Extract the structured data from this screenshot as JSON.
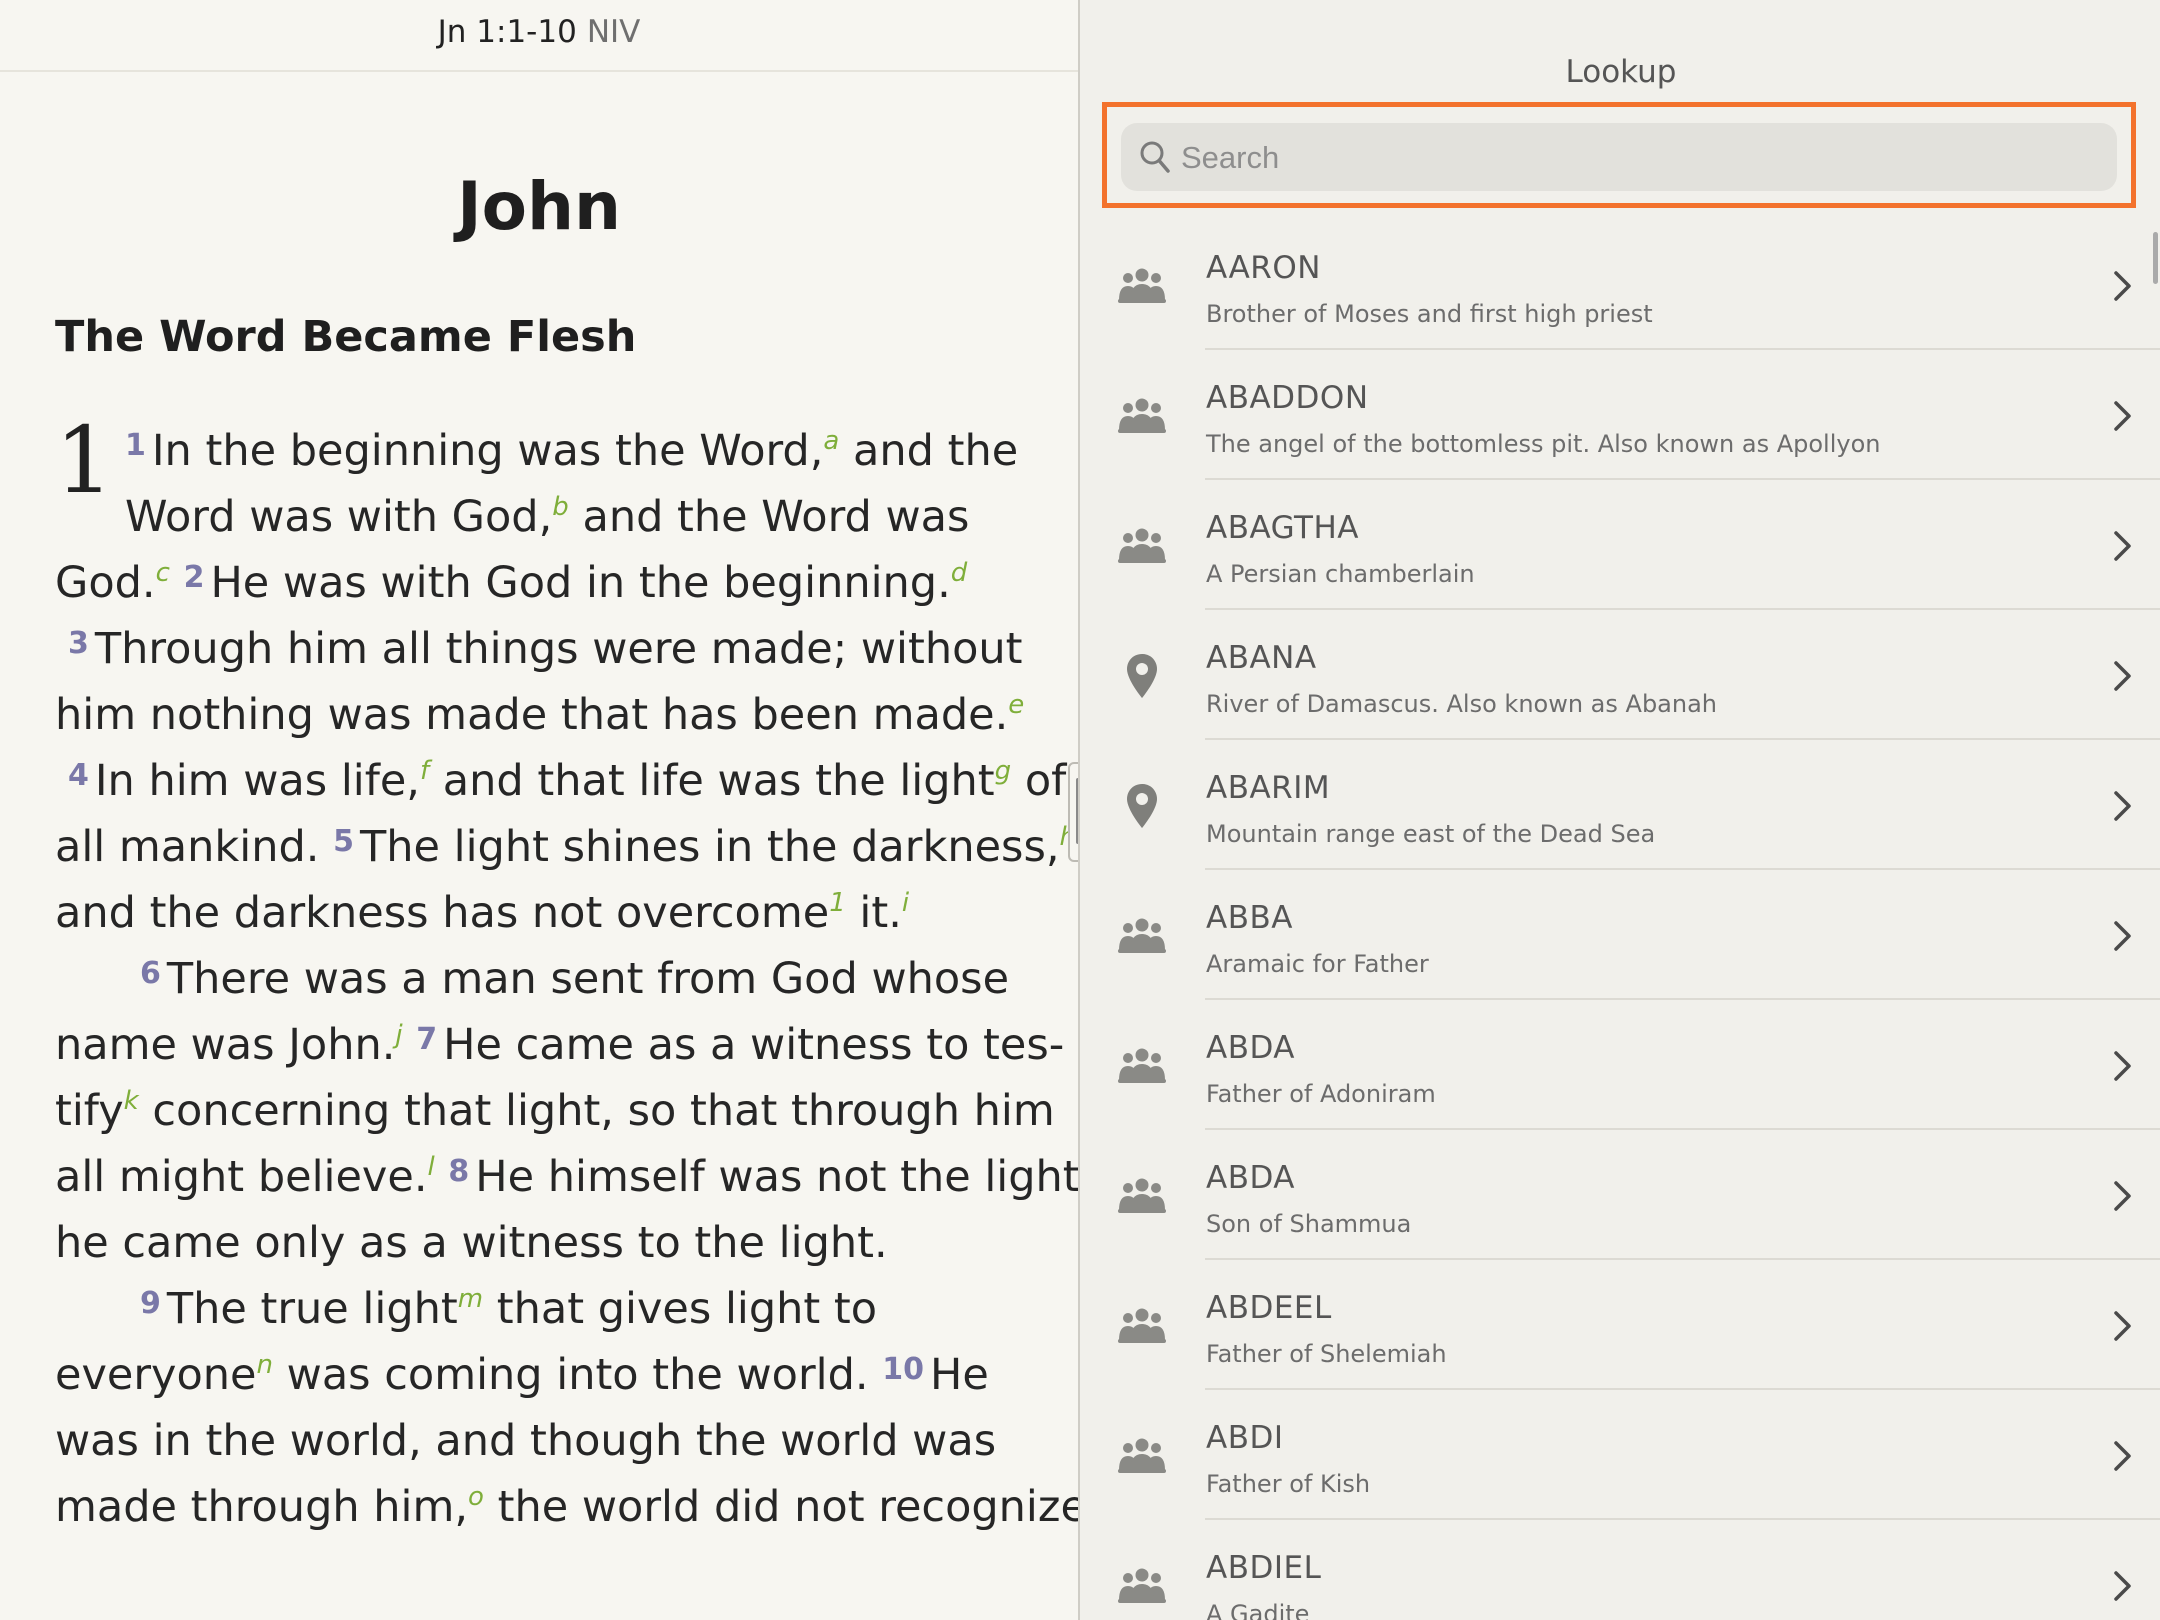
{
  "reader": {
    "reference": "Jn 1:1-10",
    "version": "NIV",
    "book_title": "John",
    "section_heading": "The Word Became Flesh",
    "chapter_number": "1",
    "lines": [
      [
        {
          "t": "n",
          "v": "1"
        },
        {
          "t": "x",
          "v": "In the beginning was the Word,"
        },
        {
          "t": "f",
          "v": "a"
        },
        {
          "t": "x",
          "v": " and the"
        }
      ],
      [
        {
          "t": "x",
          "v": "Word was with God,"
        },
        {
          "t": "f",
          "v": "b"
        },
        {
          "t": "x",
          "v": " and the Word was"
        }
      ],
      [
        {
          "t": "x",
          "v": "God."
        },
        {
          "t": "f",
          "v": "c"
        },
        {
          "t": "x",
          "v": "  "
        },
        {
          "t": "n",
          "v": "2"
        },
        {
          "t": "x",
          "v": "He was with God in the beginning."
        },
        {
          "t": "f",
          "v": "d"
        }
      ],
      [
        {
          "t": "n",
          "v": "3"
        },
        {
          "t": "x",
          "v": "Through him all things were made; without"
        }
      ],
      [
        {
          "t": "x",
          "v": "him nothing was made that has been made."
        },
        {
          "t": "f",
          "v": "e"
        }
      ],
      [
        {
          "t": "n",
          "v": "4"
        },
        {
          "t": "x",
          "v": "In him was life,"
        },
        {
          "t": "f",
          "v": "f"
        },
        {
          "t": "x",
          "v": " and that life was the light"
        },
        {
          "t": "f",
          "v": "g"
        },
        {
          "t": "x",
          "v": " of"
        }
      ],
      [
        {
          "t": "x",
          "v": "all mankind.  "
        },
        {
          "t": "n",
          "v": "5"
        },
        {
          "t": "x",
          "v": "The light shines in the darkness,"
        },
        {
          "t": "f",
          "v": "h"
        }
      ],
      [
        {
          "t": "x",
          "v": "and the darkness has not overcome"
        },
        {
          "t": "f",
          "v": "1"
        },
        {
          "t": "x",
          "v": " it."
        },
        {
          "t": "f",
          "v": "i"
        }
      ],
      [
        {
          "t": "n",
          "v": "6"
        },
        {
          "t": "x",
          "v": "There was a man sent from God whose"
        }
      ],
      [
        {
          "t": "x",
          "v": "name was John."
        },
        {
          "t": "f",
          "v": "j"
        },
        {
          "t": "x",
          "v": "  "
        },
        {
          "t": "n",
          "v": "7"
        },
        {
          "t": "x",
          "v": "He came as a witness to tes-"
        }
      ],
      [
        {
          "t": "x",
          "v": "tify"
        },
        {
          "t": "f",
          "v": "k"
        },
        {
          "t": "x",
          "v": " concerning that light, so that through him"
        }
      ],
      [
        {
          "t": "x",
          "v": "all might believe."
        },
        {
          "t": "f",
          "v": "l"
        },
        {
          "t": "x",
          "v": "  "
        },
        {
          "t": "n",
          "v": "8"
        },
        {
          "t": "x",
          "v": "He himself was not the light;"
        }
      ],
      [
        {
          "t": "x",
          "v": "he came only as a witness to the light."
        }
      ],
      [
        {
          "t": "n",
          "v": "9"
        },
        {
          "t": "x",
          "v": "The true light"
        },
        {
          "t": "f",
          "v": "m"
        },
        {
          "t": "x",
          "v": " that gives light to"
        }
      ],
      [
        {
          "t": "x",
          "v": "everyone"
        },
        {
          "t": "f",
          "v": "n"
        },
        {
          "t": "x",
          "v": " was coming into the world.  "
        },
        {
          "t": "n",
          "v": "10"
        },
        {
          "t": "x",
          "v": "He"
        }
      ],
      [
        {
          "t": "x",
          "v": "was in the world, and though the world was"
        }
      ],
      [
        {
          "t": "x",
          "v": "made through him,"
        },
        {
          "t": "f",
          "v": "o"
        },
        {
          "t": "x",
          "v": " the world did not recognize"
        }
      ]
    ]
  },
  "lookup": {
    "title": "Lookup",
    "search_placeholder": "Search",
    "items": [
      {
        "name": "AARON",
        "desc": "Brother of Moses and first high priest",
        "icon": "people-icon"
      },
      {
        "name": "ABADDON",
        "desc": "The angel of the bottomless pit. Also known as Apollyon",
        "icon": "people-icon"
      },
      {
        "name": "ABAGTHA",
        "desc": "A Persian chamberlain",
        "icon": "people-icon"
      },
      {
        "name": "ABANA",
        "desc": "River of Damascus. Also known as Abanah",
        "icon": "place-pin-icon"
      },
      {
        "name": "ABARIM",
        "desc": "Mountain range east of the Dead Sea",
        "icon": "place-pin-icon"
      },
      {
        "name": "ABBA",
        "desc": "Aramaic for Father",
        "icon": "people-icon"
      },
      {
        "name": "ABDA",
        "desc": "Father of Adoniram",
        "icon": "people-icon"
      },
      {
        "name": "ABDA",
        "desc": "Son of Shammua",
        "icon": "people-icon"
      },
      {
        "name": "ABDEEL",
        "desc": "Father of Shelemiah",
        "icon": "people-icon"
      },
      {
        "name": "ABDI",
        "desc": "Father of Kish",
        "icon": "people-icon"
      },
      {
        "name": "ABDIEL",
        "desc": "A Gadite",
        "icon": "people-icon"
      }
    ]
  },
  "colors": {
    "accent_highlight": "#f3722c",
    "verse_number": "#7a78a8",
    "footnote": "#7fae3a"
  }
}
